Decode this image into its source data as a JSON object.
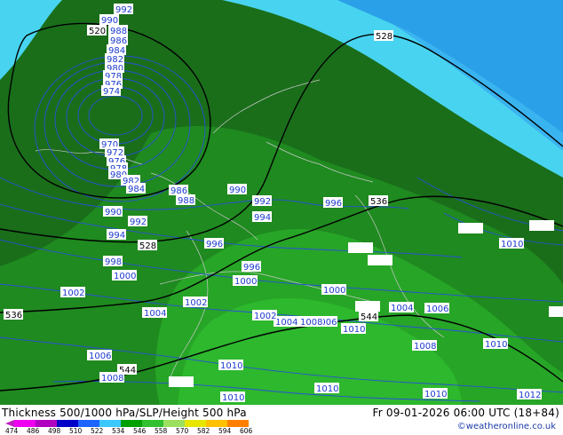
{
  "footer": {
    "title": "Thickness 500/1000 hPa/SLP/Height 500 hPa",
    "datetime": "Fr 09-01-2026 06:00 UTC (18+84)",
    "credit": "©weatheronline.co.uk"
  },
  "legend": {
    "ticks": [
      "474",
      "486",
      "498",
      "510",
      "522",
      "534",
      "546",
      "558",
      "570",
      "582",
      "594",
      "606"
    ],
    "colors": [
      "#f000f0",
      "#b000c0",
      "#0000c8",
      "#1e64ff",
      "#3cc8ff",
      "#00a000",
      "#30c030",
      "#9de060",
      "#e6e600",
      "#ffc000",
      "#ff8000"
    ]
  },
  "map": {
    "colors": {
      "thickness_522_534": "#1e7d1e",
      "thickness_534_546": "#229a22",
      "thickness_546_558": "#2cb82c",
      "thickness_cyan": "#3cc8f0",
      "thickness_blue": "#32aaf0",
      "slp_isobar": "#2040d0",
      "height_contour": "#000000"
    },
    "height_labels": [
      "520",
      "528",
      "528",
      "536",
      "536",
      "544",
      "544"
    ],
    "pressure_labels": [
      "992",
      "990",
      "988",
      "986",
      "984",
      "982",
      "980",
      "978",
      "976",
      "974",
      "970",
      "972",
      "976",
      "978",
      "980",
      "982",
      "984",
      "986",
      "988",
      "990",
      "992",
      "994",
      "996",
      "990",
      "992",
      "994",
      "996",
      "998",
      "1000",
      "1002",
      "1004",
      "1006",
      "1008",
      "1010",
      "996",
      "998",
      "1000",
      "1002",
      "1004",
      "1006",
      "1008",
      "1010",
      "1012",
      "1000",
      "1002",
      "1004",
      "1006",
      "1008",
      "1010",
      "1010",
      "1010",
      "1010",
      "1010"
    ]
  }
}
